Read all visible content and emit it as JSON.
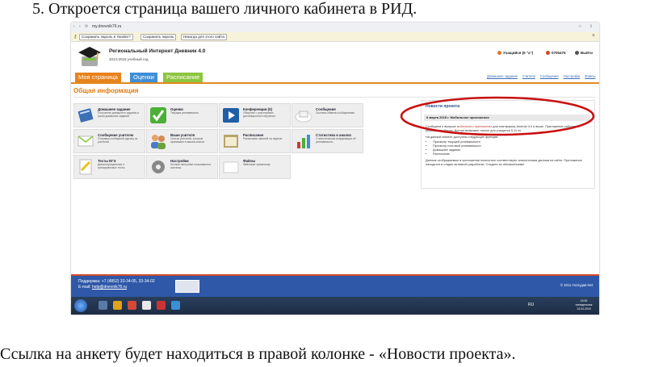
{
  "caption_top": "5.  Откроется страница вашего личного кабинета в РИД.",
  "caption_bottom": "Ссылка на анкету будет находиться в правой колонке - «Новости проекта».",
  "browser": {
    "url": "my.dnevnik76.ru",
    "password_buttons": [
      "Сохранить пароль в Yandex?",
      "Сохранить пароль",
      "Никогда для этого сайта"
    ]
  },
  "site": {
    "title": "Региональный Интернет Дневник 4.0",
    "year": "2014-2015 учебный год",
    "user": "Учащийся (6 \"а\")",
    "phone": "0705475",
    "logout": "Выйти"
  },
  "tabs": [
    {
      "label": "Моя страница",
      "color": "#e8821c"
    },
    {
      "label": "Оценки",
      "color": "#3f8ed8"
    },
    {
      "label": "Расписание",
      "color": "#8cc63f"
    }
  ],
  "top_links": [
    "Домашнее задание",
    "Учителя",
    "Сообщения",
    "Настройки",
    "Файлы"
  ],
  "section_title": "Общая информация",
  "tiles": [
    {
      "title": "Домашнее задание",
      "desc": "Получение домашнего задания и сроки домашних заданий",
      "icon": "book-icon"
    },
    {
      "title": "Оценки",
      "desc": "Текущая успеваемость",
      "icon": "check-icon"
    },
    {
      "title": "Конференции (0)",
      "desc": "Общение с участниками дистанционного обучения",
      "icon": "video-icon"
    },
    {
      "title": "Сообщения",
      "desc": "Система обмена сообщениями",
      "icon": "mail-icon"
    },
    {
      "title": "Сообщение учителю",
      "desc": "Отправка сообщений одному из учителей",
      "icon": "envelope-icon"
    },
    {
      "title": "Ваши учителя",
      "desc": "Список учителей, которые принимают в вашем классе",
      "icon": "people-icon"
    },
    {
      "title": "Расписание",
      "desc": "Расписание занятий на неделю",
      "icon": "calendar-icon"
    },
    {
      "title": "Статистика и анализ",
      "desc": "Статистическая информация об успеваемости",
      "icon": "chart-icon"
    },
    {
      "title": "Тесты ЕГЭ",
      "desc": "Демонстрационные и тренировочные тесты",
      "icon": "test-icon"
    },
    {
      "title": "Настройки",
      "desc": "Личные настройки пользователя системы",
      "icon": "gear-icon"
    },
    {
      "title": "Файлы",
      "desc": "Файловое хранилище",
      "icon": "folder-icon"
    }
  ],
  "news": {
    "title": "Новости проекта",
    "date_title": "6 марта 2015 г.   Мобильное приложение",
    "p1_start": "Сообщаем о выпуске ",
    "p1_link": "мобильного приложения",
    "p1_end": " для платформы Android 4.0 и выше. Приложение работает в режиме апробации. Доступ возможен только для учащихся 5-11 кл.",
    "p2": "На данный момент доступны следующие функции:",
    "items": [
      "Просмотр текущей успеваемости",
      "Просмотр итоговой успеваемости",
      "Домашнее задание",
      "Расписание"
    ],
    "p3": "Данные отображаемые в приложении полностью соответствуют аналогичным данным на сайте. Приложение находится в стадии активной разработки. Следите за обновлениями!"
  },
  "footer": {
    "support_label": "Поддержка:",
    "support_phones": "+7 (4852) 33-34-05, 33-34-02",
    "email_label": "E-mail:",
    "email": "help@dnevnik76.ru",
    "copyright": "© 2011 Гаслудав Net"
  },
  "taskbar": {
    "lang": "RU",
    "time": "13:00",
    "day": "понедельник",
    "date": "13.04.2015"
  }
}
